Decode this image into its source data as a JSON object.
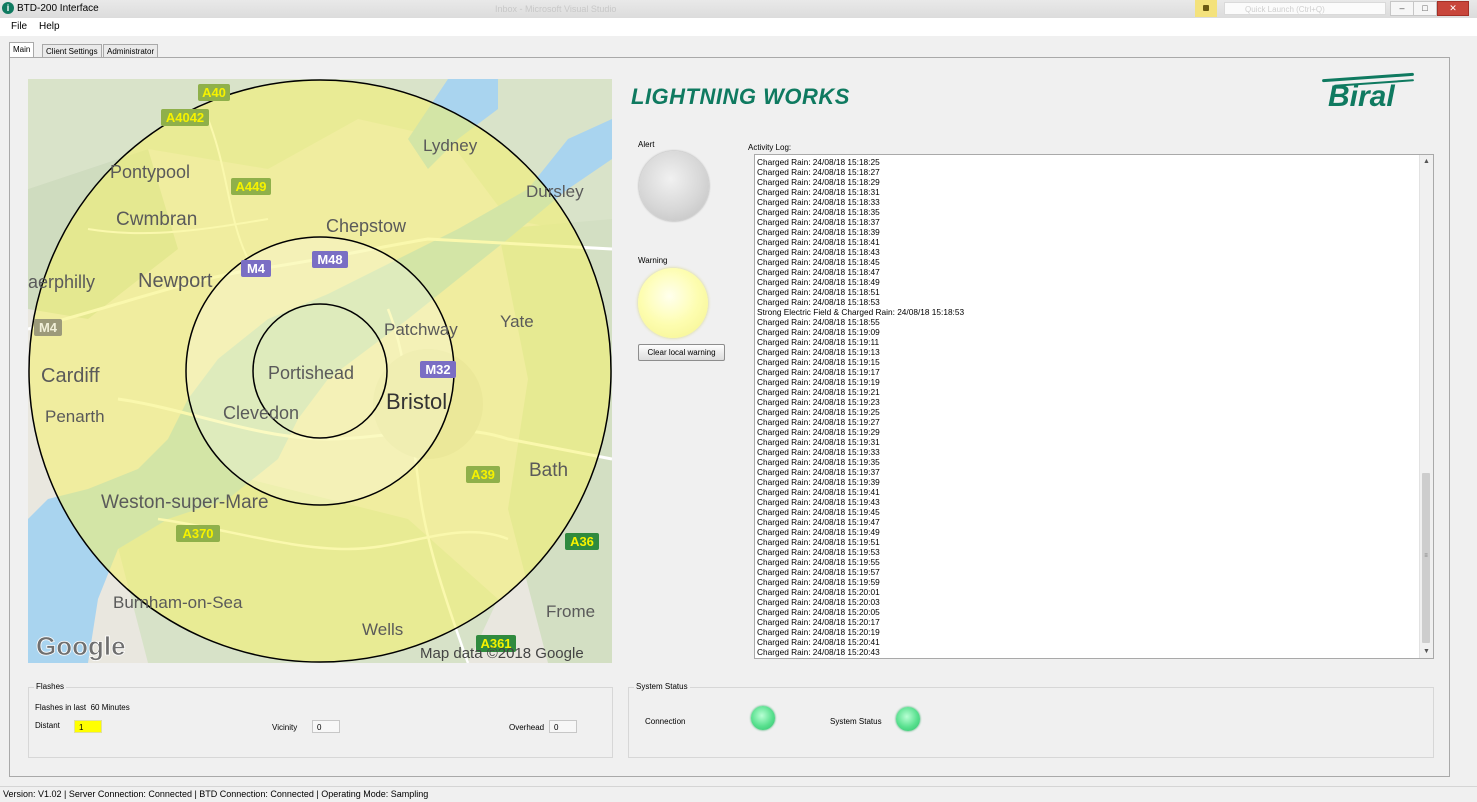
{
  "window": {
    "title": "BTD-200 Interface",
    "background_title": "Inbox - Microsoft Visual Studio",
    "quick_launch": "Quick Launch (Ctrl+Q)"
  },
  "menu": {
    "file": "File",
    "help": "Help"
  },
  "tabs": [
    {
      "label": "Main"
    },
    {
      "label": "Client Settings"
    },
    {
      "label": "Administrator"
    }
  ],
  "brand": {
    "title": "LIGHTNING WORKS",
    "logo": "Biral"
  },
  "map": {
    "labels": [
      "A40",
      "A4042",
      "Lydney",
      "Pontypool",
      "A449",
      "Dursley",
      "Cwmbran",
      "Chepstow",
      "M4",
      "M48",
      "aerphilly",
      "Newport",
      "Yate",
      "M4",
      "Patchway",
      "Cardiff",
      "Portishead",
      "M32",
      "Clevedon",
      "Bristol",
      "Penarth",
      "Bath",
      "A39",
      "Weston-super-Mare",
      "A370",
      "A36",
      "Burnham-on-Sea",
      "Frome",
      "Wells",
      "A361"
    ],
    "google_logo": "Google",
    "attribution": "Map data ©2018 Google"
  },
  "alert": {
    "label": "Alert",
    "state": "off",
    "color": "#d0d0d0"
  },
  "warning": {
    "label": "Warning",
    "state": "on",
    "color": "#fbfaa0"
  },
  "clear_button": "Clear local warning",
  "activity_log": {
    "label": "Activity Log:",
    "lines": [
      "Charged Rain: 24/08/18 15:18:25",
      "Charged Rain: 24/08/18 15:18:27",
      "Charged Rain: 24/08/18 15:18:29",
      "Charged Rain: 24/08/18 15:18:31",
      "Charged Rain: 24/08/18 15:18:33",
      "Charged Rain: 24/08/18 15:18:35",
      "Charged Rain: 24/08/18 15:18:37",
      "Charged Rain: 24/08/18 15:18:39",
      "Charged Rain: 24/08/18 15:18:41",
      "Charged Rain: 24/08/18 15:18:43",
      "Charged Rain: 24/08/18 15:18:45",
      "Charged Rain: 24/08/18 15:18:47",
      "Charged Rain: 24/08/18 15:18:49",
      "Charged Rain: 24/08/18 15:18:51",
      "Charged Rain: 24/08/18 15:18:53",
      "Strong Electric Field & Charged Rain: 24/08/18 15:18:53",
      "Charged Rain: 24/08/18 15:18:55",
      "Charged Rain: 24/08/18 15:19:09",
      "Charged Rain: 24/08/18 15:19:11",
      "Charged Rain: 24/08/18 15:19:13",
      "Charged Rain: 24/08/18 15:19:15",
      "Charged Rain: 24/08/18 15:19:17",
      "Charged Rain: 24/08/18 15:19:19",
      "Charged Rain: 24/08/18 15:19:21",
      "Charged Rain: 24/08/18 15:19:23",
      "Charged Rain: 24/08/18 15:19:25",
      "Charged Rain: 24/08/18 15:19:27",
      "Charged Rain: 24/08/18 15:19:29",
      "Charged Rain: 24/08/18 15:19:31",
      "Charged Rain: 24/08/18 15:19:33",
      "Charged Rain: 24/08/18 15:19:35",
      "Charged Rain: 24/08/18 15:19:37",
      "Charged Rain: 24/08/18 15:19:39",
      "Charged Rain: 24/08/18 15:19:41",
      "Charged Rain: 24/08/18 15:19:43",
      "Charged Rain: 24/08/18 15:19:45",
      "Charged Rain: 24/08/18 15:19:47",
      "Charged Rain: 24/08/18 15:19:49",
      "Charged Rain: 24/08/18 15:19:51",
      "Charged Rain: 24/08/18 15:19:53",
      "Charged Rain: 24/08/18 15:19:55",
      "Charged Rain: 24/08/18 15:19:57",
      "Charged Rain: 24/08/18 15:19:59",
      "Charged Rain: 24/08/18 15:20:01",
      "Charged Rain: 24/08/18 15:20:03",
      "Charged Rain: 24/08/18 15:20:05",
      "Charged Rain: 24/08/18 15:20:17",
      "Charged Rain: 24/08/18 15:20:19",
      "Charged Rain: 24/08/18 15:20:41",
      "Charged Rain: 24/08/18 15:20:43"
    ]
  },
  "flashes": {
    "title": "Flashes",
    "period_label": "Flashes in last",
    "period_value": "60",
    "period_unit": "Minutes",
    "distant_label": "Distant",
    "distant_value": "1",
    "vicinity_label": "Vicinity",
    "vicinity_value": "0",
    "overhead_label": "Overhead",
    "overhead_value": "0"
  },
  "system_status": {
    "title": "System Status",
    "connection_label": "Connection",
    "connection_state": "ok",
    "status_label": "System Status",
    "status_state": "ok",
    "ok_color": "#4fdc88"
  },
  "statusbar": {
    "text": "Version:  V1.02  |  Server Connection:  Connected  |  BTD Connection:  Connected  |  Operating Mode:  Sampling"
  }
}
